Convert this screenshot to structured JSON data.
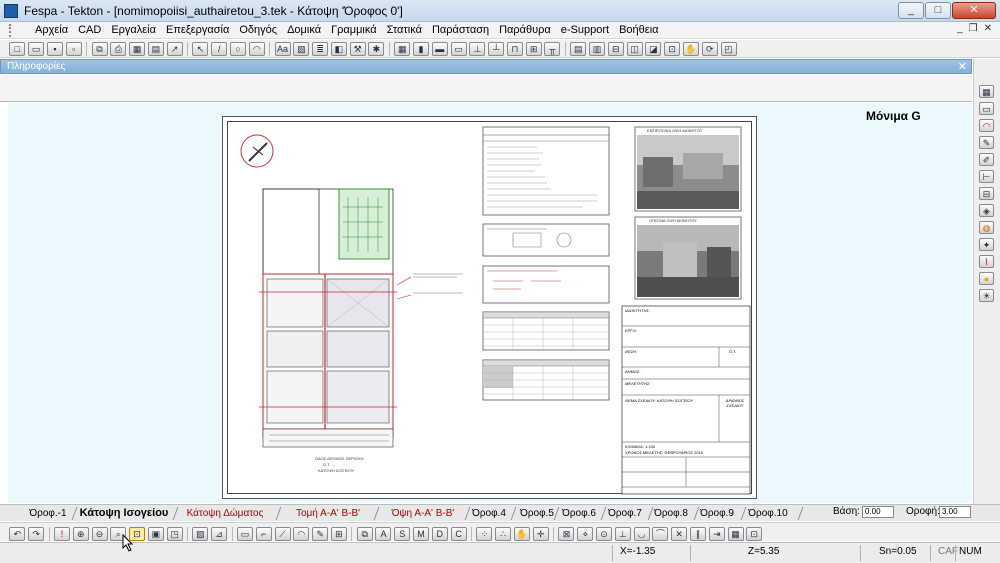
{
  "window": {
    "title": "Fespa - Tekton - [nomimopoiisi_authairetou_3.tek - Κάτοψη 'Όροφος 0']"
  },
  "menu": {
    "items": [
      "Αρχεία",
      "CAD",
      "Εργαλεία",
      "Επεξεργασία",
      "Οδηγός",
      "Δομικά",
      "Γραμμικά",
      "Στατικά",
      "Παράσταση",
      "Παράθυρα",
      "e-Support",
      "Βοήθεια"
    ]
  },
  "info_panel": {
    "title": "Πληροφορίες"
  },
  "canvas": {
    "model_label": "Μόνιμα G",
    "sheet": {
      "floorplan_caption": "ΟΔΟΣ ΔΡΟΜΟΣ ΠΕΡΙΟΧΗ",
      "floorplan_caption_2": "Ο.Τ. ...",
      "floorplan_caption_3": "ΚΑΤΟΨΗ ΙΣΟΓΕΙΟΥ",
      "photo_1_caption": "ΕΜΠΡΟΣΘΙΑ ΟΨΗ ΑΚΙΝΗΤΟΥ",
      "photo_2_caption": "ΟΠΙΣΘΙΑ ΟΨΗ ΑΚΙΝΗΤΟΥ",
      "title_block": {
        "owner_label": "ΙΔΙΟΚΤΗΤΗΣ:",
        "project_label": "ΕΡΓΟ:",
        "location_label": "ΘΕΣΗ:",
        "location_value": "Ο.Τ.",
        "municipality_label": "ΔΗΜΟΣ:",
        "study_label": "ΜΕΛΕΤΗΤΗΣ:",
        "drawing_label": "ΘΕΜΑ ΣΧΕΔΙΟΥ: ΚΑΤΟΨΗ ΙΣΟΓΕΙΟΥ",
        "drawing_number_label": "ΑΡΙΘΜΟΣ ΣΧΕΔΙΟΥ",
        "scale_label": "ΚΛΙΜΑΚΑ: 1:100",
        "date_label": "ΧΡΟΝΟΣ ΜΕΛΕΤΗΣ: ΦΕΒΡΟΥΑΡΙΟΣ 2016"
      }
    }
  },
  "tabs": {
    "items": [
      {
        "label": "Όροφ.-1",
        "style": "normal"
      },
      {
        "label": "Κάτοψη Ισογείου",
        "style": "active"
      },
      {
        "label": "Κάτοψη Δώματος",
        "style": "red"
      },
      {
        "label": "Τομή Α-Α' Β-Β'",
        "style": "red"
      },
      {
        "label": "Όψη Α-Α' Β-Β'",
        "style": "red"
      },
      {
        "label": "Όροφ.4",
        "style": "normal"
      },
      {
        "label": "Όροφ.5",
        "style": "normal"
      },
      {
        "label": "Όροφ.6",
        "style": "normal"
      },
      {
        "label": "Όροφ.7",
        "style": "normal"
      },
      {
        "label": "Όροφ.8",
        "style": "normal"
      },
      {
        "label": "Όροφ.9",
        "style": "normal"
      },
      {
        "label": "Όροφ.10",
        "style": "normal"
      }
    ],
    "basis_label": "Βάση:",
    "basis_value": "0.00",
    "roof_label": "Οροφή:",
    "roof_value": "3.00"
  },
  "status": {
    "x": "X=-1.35",
    "z": "Z=5.35",
    "sn": "Sn=0.05",
    "caf": "CAF",
    "num": "NUM"
  },
  "colors": {
    "canvas_bg": "#ebf9fc",
    "info_bar": "#8cb6dd",
    "active_tab_text": "#000000",
    "red_tab_text": "#b00000"
  }
}
